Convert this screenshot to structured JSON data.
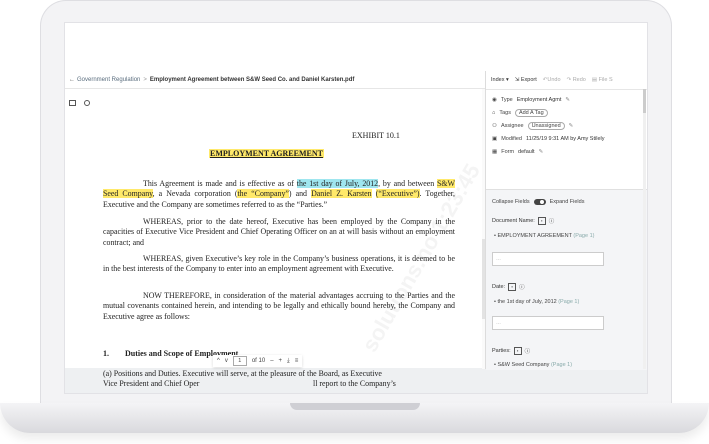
{
  "breadcrumb": {
    "parent": "Government Regulation",
    "separator": ">",
    "current": "Employment Agreement between S&W Seed Co. and Daniel Karsten.pdf"
  },
  "document": {
    "exhibit": "EXHIBIT 10.1",
    "title": "EMPLOYMENT AGREEMENT",
    "p1": {
      "a": "This Agreement is made and is effective as of ",
      "date": "the 1st day of July, 2012",
      "b": ", by and between ",
      "party1": "S&W Seed Company",
      "c": ", a Nevada corporation (",
      "company": "the “Company”",
      "d": ") and ",
      "party2": "Daniel Z. Karsten",
      "e": " ",
      "exec": "(“Executive”)",
      "f": ". Together, Executive and the Company are sometimes referred to as the “Parties.”"
    },
    "p2": "WHEREAS, prior to the date hereof, Executive has been employed by the Company in the capacities of Executive Vice President and Chief Operating Officer on an at will basis without an employment contract; and",
    "p3": "WHEREAS, given Executive’s key role in the Company’s business operations, it is deemed to be in the best interests of the Company to enter into an employment agreement with Executive.",
    "p4": "NOW THEREFORE, in consideration of the material advantages accruing to the Parties and the mutual covenants contained herein, and intending to be legally and ethically bound hereby, the Company and Executive agree as follows:",
    "section1_num": "1.",
    "section1": "Duties and Scope of Employment",
    "p5a": "(a)      Positions and Duties. Executive will serve, at the pleasure of the Board, as Executive",
    "p5b_left": "Vice President and Chief Oper",
    "p5b_right": "ll report to the Company’s",
    "watermark": "solutions.no 1:23:45"
  },
  "pager": {
    "page": "1",
    "of": "of 10",
    "up": "^",
    "down": "v",
    "minus": "–",
    "plus": "+",
    "download": "⤓",
    "menu": "≡"
  },
  "toolbar": {
    "index": "Index ▾",
    "export": "Export",
    "undo": "Undo",
    "redo": "Redo",
    "file": "File S"
  },
  "metadata": {
    "type_key": "Type",
    "type_val": "Employment Agmt",
    "tags_key": "Tags",
    "tags_val": "Add A Tag",
    "assignee_key": "Assignee",
    "assignee_val": "Unassigned",
    "modified_key": "Modified",
    "modified_val": "11/25/19 9:31 AM by Amy Stilely",
    "form_key": "Form",
    "form_val": "default"
  },
  "fields": {
    "collapse": "Collapse Fields",
    "expand": "Expand Fields",
    "doc_name_label": "Document Name:",
    "doc_name_val": "EMPLOYMENT AGREEMENT",
    "doc_name_page": "(Page 1)",
    "date_label": "Date:",
    "date_val": "the 1st day of July, 2012",
    "date_page": "(Page 1)",
    "parties_label": "Parties:",
    "parties_val": "S&W Seed Company",
    "parties_page": "(Page 1)",
    "input_placeholder": "…"
  },
  "colors": {
    "highlight_blue": "#9fe6ef",
    "highlight_yellow": "#ffe96a"
  },
  "icons": [
    "layout-icon",
    "search-icon",
    "tag-icon",
    "user-icon",
    "calendar-icon",
    "form-icon",
    "pencil-icon",
    "info-icon",
    "toggle-icon"
  ]
}
